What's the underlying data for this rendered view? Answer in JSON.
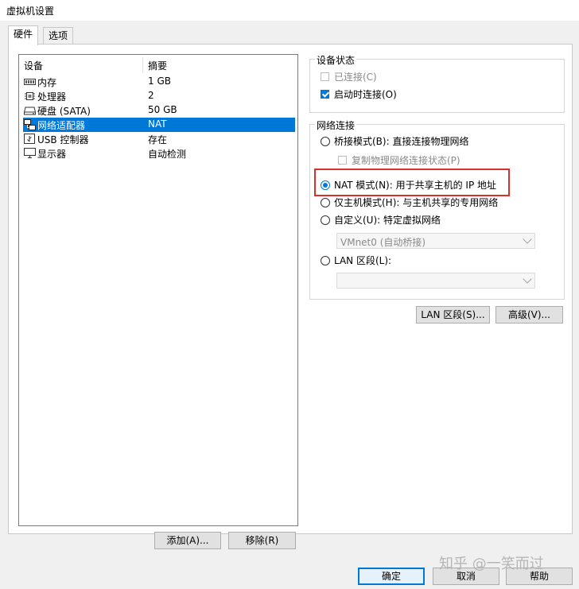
{
  "window": {
    "title": "虚拟机设置"
  },
  "tabs": [
    {
      "label": "硬件"
    },
    {
      "label": "选项"
    }
  ],
  "device_list": {
    "headers": {
      "device": "设备",
      "summary": "摘要"
    },
    "rows": [
      {
        "name": "内存",
        "summary": "1 GB",
        "icon": "memory-icon"
      },
      {
        "name": "处理器",
        "summary": "2",
        "icon": "processor-icon"
      },
      {
        "name": "硬盘 (SATA)",
        "summary": "50 GB",
        "icon": "hard-disk-icon"
      },
      {
        "name": "网络适配器",
        "summary": "NAT",
        "icon": "network-adapter-icon",
        "selected": true
      },
      {
        "name": "USB 控制器",
        "summary": "存在",
        "icon": "usb-icon"
      },
      {
        "name": "显示器",
        "summary": "自动检测",
        "icon": "monitor-icon"
      }
    ]
  },
  "device_status": {
    "title": "设备状态",
    "connected": {
      "label": "已连接(C)",
      "checked": false,
      "disabled": true
    },
    "connect_at_power_on": {
      "label": "启动时连接(O)",
      "checked": true
    }
  },
  "network_connection": {
    "title": "网络连接",
    "bridged": {
      "label": "桥接模式(B): 直接连接物理网络"
    },
    "replicate": {
      "label": "复制物理网络连接状态(P)",
      "disabled": true
    },
    "nat": {
      "label": "NAT 模式(N): 用于共享主机的 IP 地址",
      "selected": true
    },
    "host_only": {
      "label": "仅主机模式(H): 与主机共享的专用网络"
    },
    "custom": {
      "label": "自定义(U): 特定虚拟网络"
    },
    "custom_select": {
      "value": "VMnet0 (自动桥接)"
    },
    "lan_segment": {
      "label": "LAN 区段(L):"
    },
    "lan_select": {
      "value": ""
    }
  },
  "buttons": {
    "lan_segments": "LAN 区段(S)...",
    "advanced": "高级(V)...",
    "add": "添加(A)...",
    "remove": "移除(R)",
    "ok": "确定",
    "cancel": "取消",
    "help": "帮助"
  },
  "watermark": {
    "text": "知乎 @一笑而过"
  },
  "colors": {
    "selection": "#0078d7",
    "highlight_box": "#d9302c"
  }
}
